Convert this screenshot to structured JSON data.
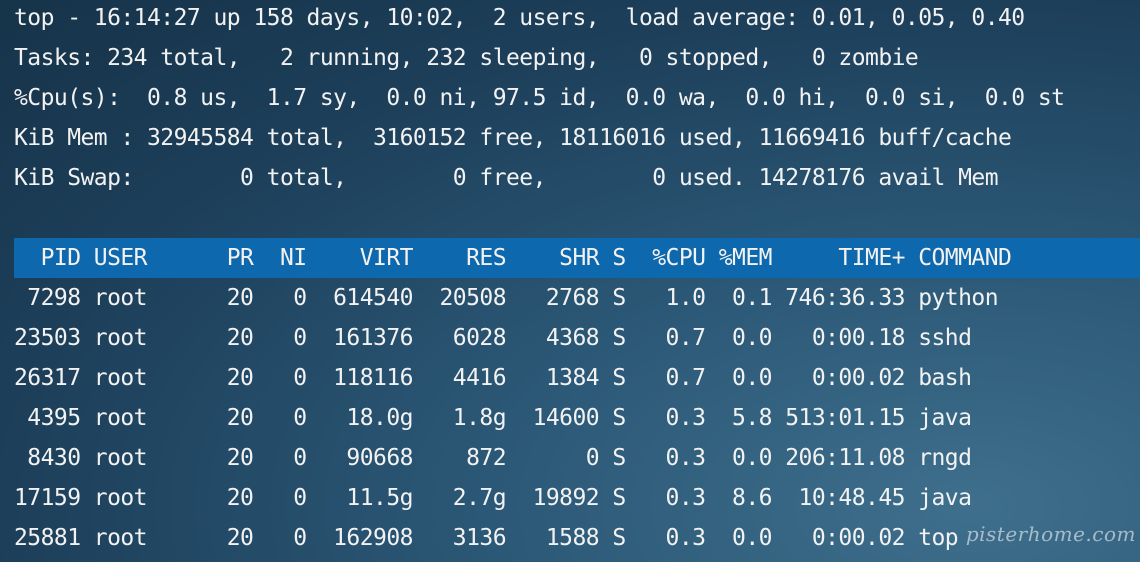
{
  "summary": {
    "line_top": "top - 16:14:27 up 158 days, 10:02,  2 users,  load average: 0.01, 0.05, 0.40",
    "line_tasks": "Tasks: 234 total,   2 running, 232 sleeping,   0 stopped,   0 zombie",
    "line_cpu": "%Cpu(s):  0.8 us,  1.7 sy,  0.0 ni, 97.5 id,  0.0 wa,  0.0 hi,  0.0 si,  0.0 st",
    "line_mem": "KiB Mem : 32945584 total,  3160152 free, 18116016 used, 11669416 buff/cache",
    "line_swap": "KiB Swap:        0 total,        0 free,        0 used. 14278176 avail Mem"
  },
  "process_table": {
    "header": "  PID USER      PR  NI    VIRT    RES    SHR S  %CPU %MEM     TIME+ COMMAND",
    "rows": [
      " 7298 root      20   0  614540  20508   2768 S   1.0  0.1 746:36.33 python",
      "23503 root      20   0  161376   6028   4368 S   0.7  0.0   0:00.18 sshd",
      "26317 root      20   0  118116   4416   1384 S   0.7  0.0   0:00.02 bash",
      " 4395 root      20   0   18.0g   1.8g  14600 S   0.3  5.8 513:01.15 java",
      " 8430 root      20   0   90668    872      0 S   0.3  0.0 206:11.08 rngd",
      "17159 root      20   0   11.5g   2.7g  19892 S   0.3  8.6  10:48.45 java",
      "25881 root      20   0  162908   3136   1588 S   0.3  0.0   0:00.02 top"
    ]
  },
  "watermark": "pisterhome.com",
  "colors": {
    "header_bar": "#0e68ad",
    "text": "#f2f2f2",
    "background": "#1d3f5a"
  }
}
